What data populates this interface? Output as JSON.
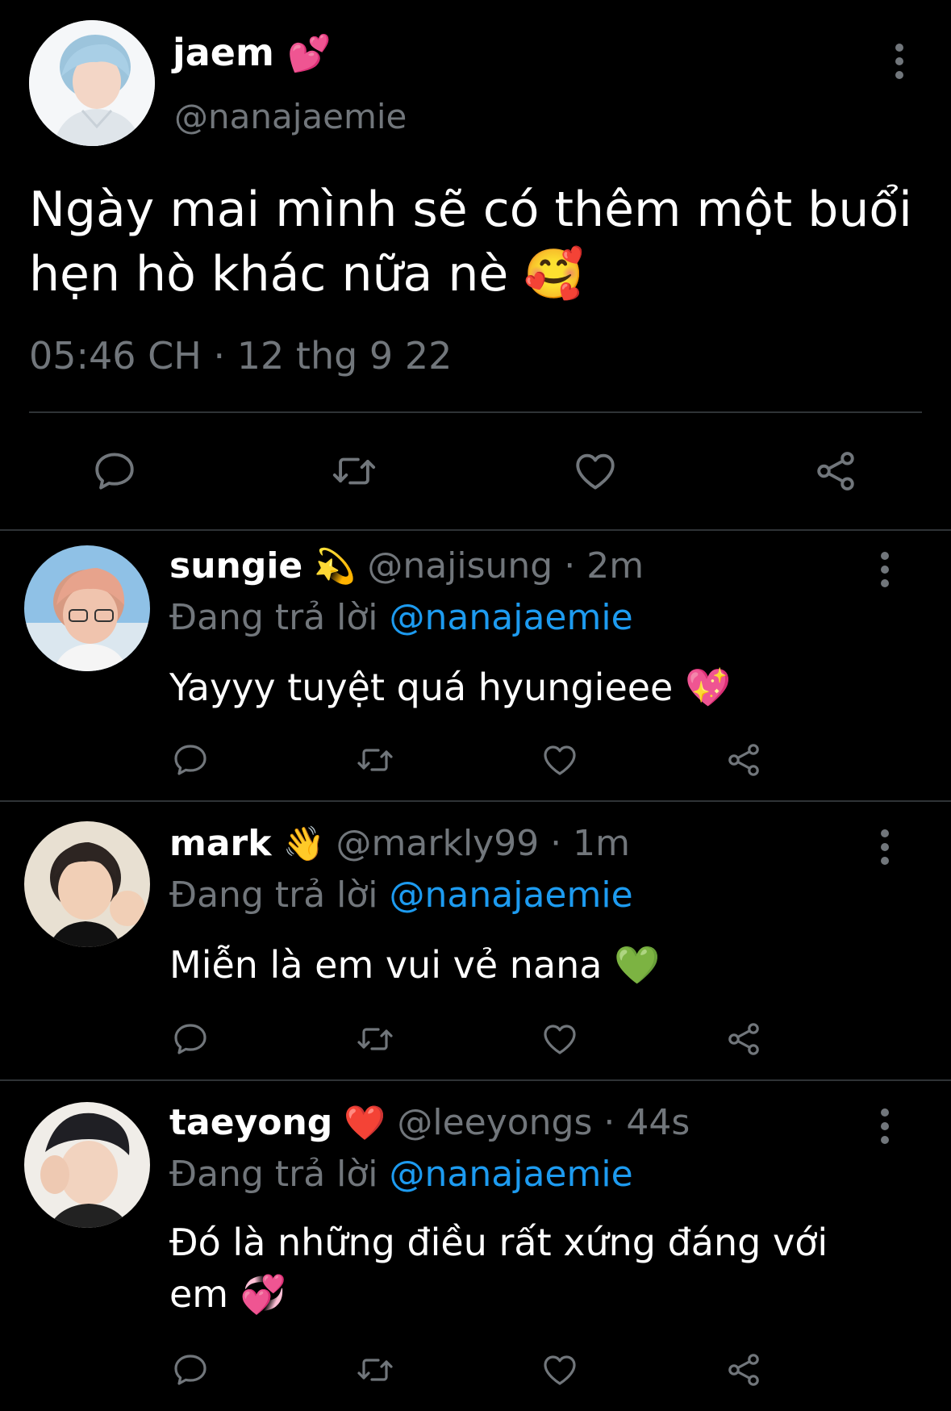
{
  "main_tweet": {
    "name": "jaem",
    "name_emoji": "💕",
    "handle": "@nanajaemie",
    "text": "Ngày mai mình sẽ có thêm một buổi hẹn hò khác nữa nè 🥰",
    "timestamp": "05:46 CH · 12 thg 9 22",
    "actions": [
      "reply-icon",
      "retweet-icon",
      "like-icon",
      "share-icon"
    ]
  },
  "replies": [
    {
      "name": "sungie",
      "emoji": "💫",
      "handle_time": "@najisung · 2m",
      "replying_label": "Đang trả lời",
      "replying_to": "@nanajaemie",
      "text": "Yayyy tuyệt quá hyungieee 💖"
    },
    {
      "name": "mark",
      "emoji": "👋",
      "handle_time": "@markly99 · 1m",
      "replying_label": "Đang trả lời",
      "replying_to": "@nanajaemie",
      "text": "Miễn là em vui vẻ nana 💚"
    },
    {
      "name": "taeyong",
      "emoji": "❤️",
      "handle_time": "@leeyongs · 44s",
      "replying_label": "Đang trả lời",
      "replying_to": "@nanajaemie",
      "text": "Đó là những điều rất xứng đáng với em 💞"
    }
  ],
  "colors": {
    "background": "#000000",
    "text": "#ffffff",
    "muted": "#71767b",
    "link": "#1d9bf0",
    "divider": "#2f3336"
  }
}
